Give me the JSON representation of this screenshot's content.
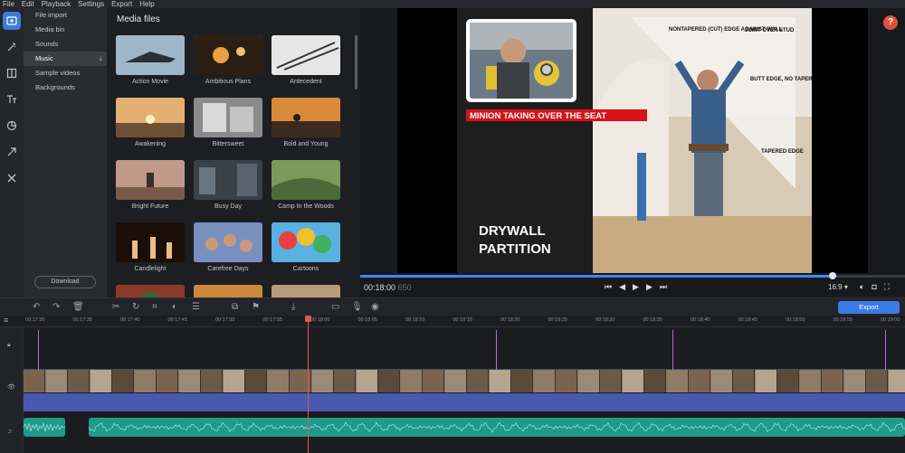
{
  "menu": [
    "File",
    "Edit",
    "Playback",
    "Settings",
    "Export",
    "Help"
  ],
  "categories": [
    {
      "label": "File import"
    },
    {
      "label": "Media bin"
    },
    {
      "label": "Sounds"
    },
    {
      "label": "Music",
      "active": true
    },
    {
      "label": "Sample videos"
    },
    {
      "label": "Backgrounds"
    }
  ],
  "download_label": "Download",
  "media_panel": {
    "title": "Media files",
    "tiles": [
      {
        "label": "Action Movie",
        "color": "#8aa5c0"
      },
      {
        "label": "Ambitious Plans",
        "color": "#a06a3c"
      },
      {
        "label": "Antecedent",
        "color": "#d6d6d6"
      },
      {
        "label": "Awakening",
        "color": "#d8a35a"
      },
      {
        "label": "Bittersweet",
        "color": "#b0b0b0"
      },
      {
        "label": "Bold and Young",
        "color": "#c9742c"
      },
      {
        "label": "Bright Future",
        "color": "#9d7a6e"
      },
      {
        "label": "Busy Day",
        "color": "#4f5860"
      },
      {
        "label": "Camp In the Woods",
        "color": "#6a8a4c"
      },
      {
        "label": "Candlelight",
        "color": "#6b3a14"
      },
      {
        "label": "Carefree Days",
        "color": "#6b86b5"
      },
      {
        "label": "Cartoons",
        "color": "#4fa5d8"
      },
      {
        "label": "",
        "color": "#8a3a2a"
      },
      {
        "label": "",
        "color": "#c88a3a"
      },
      {
        "label": "",
        "color": "#b79a7a"
      }
    ]
  },
  "preview": {
    "overlay_title": "MINION TAKING OVER THE SEAT",
    "headline": [
      "DRYWALL",
      "PARTITION"
    ],
    "annotations": [
      "NONTAPERED (CUT) EDGE AGAINST WALL",
      "JOINT OVER STUD",
      "BUTT EDGE, NO TAPER",
      "TAPERED EDGE"
    ],
    "help": "?",
    "timecode": "00:18:00",
    "timecode_frames": "650",
    "aspect": "16:9",
    "aspect_arrow": "▾",
    "progress": 0.866
  },
  "timeline": {
    "export_label": "Export",
    "ruler": [
      "00:17:30",
      "00:17:35",
      "00:17:40",
      "00:17:45",
      "00:17:50",
      "00:17:55",
      "00:18:00",
      "00:18:05",
      "00:18:10",
      "00:18:15",
      "00:18:20",
      "00:18:25",
      "00:18:30",
      "00:18:35",
      "00:18:40",
      "00:18:45",
      "00:18:50",
      "00:18:55",
      "00:19:00",
      "00:19:05"
    ]
  },
  "colors": {
    "accent": "#3b7be8",
    "help": "#e0523e",
    "audio_clip": "#4a58b0",
    "music_clip": "#1f9a8b",
    "marker": "#b86ad6",
    "playhead": "#e05555"
  },
  "icons": {
    "rail": [
      "import-icon",
      "magic-icon",
      "transitions-icon",
      "titles-icon",
      "stickers-icon",
      "arrow-icon",
      "tools-icon"
    ],
    "toolbar": [
      "undo-icon",
      "redo-icon",
      "delete-icon",
      "cut-icon",
      "rotate-icon",
      "crop-icon",
      "color-icon",
      "properties-icon",
      "overlay-icon",
      "flag-icon",
      "insert-icon",
      "monitor-icon",
      "mic-icon",
      "webcam-icon"
    ]
  }
}
